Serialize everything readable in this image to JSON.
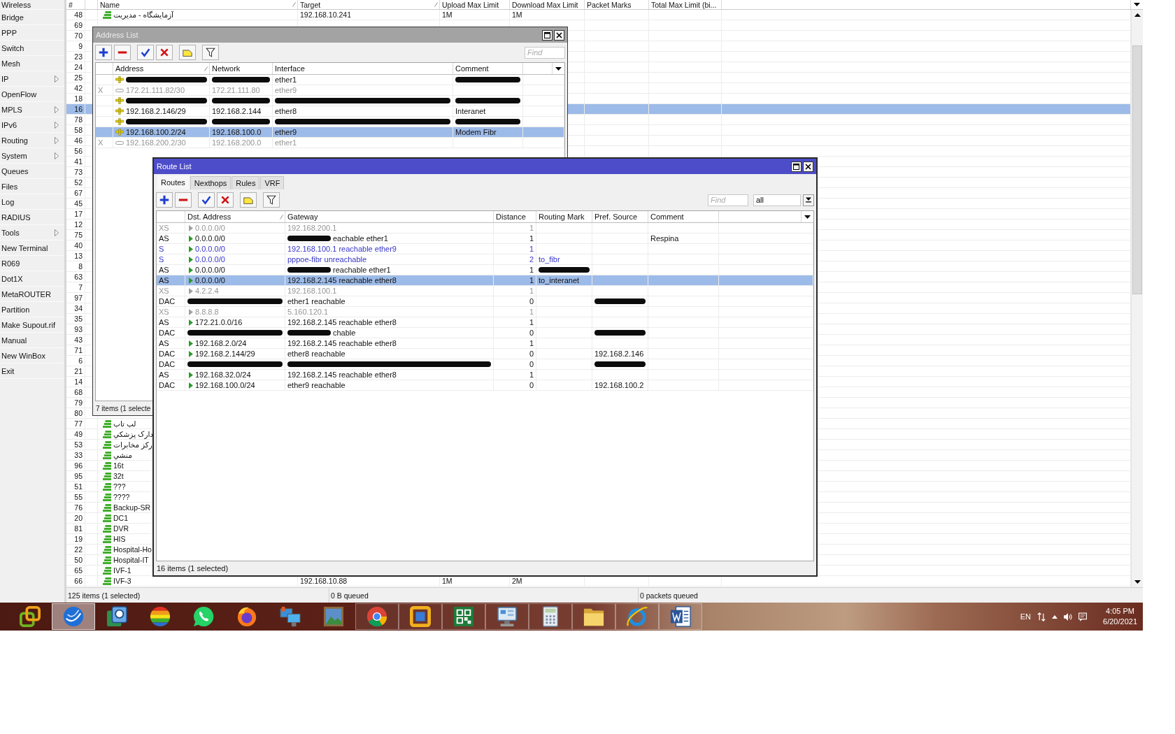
{
  "sidebar": {
    "items": [
      {
        "label": "Wireless",
        "submenu": false
      },
      {
        "label": "Bridge",
        "submenu": false
      },
      {
        "label": "PPP",
        "submenu": false
      },
      {
        "label": "Switch",
        "submenu": false
      },
      {
        "label": "Mesh",
        "submenu": false
      },
      {
        "label": "IP",
        "submenu": true
      },
      {
        "label": "OpenFlow",
        "submenu": false
      },
      {
        "label": "MPLS",
        "submenu": true
      },
      {
        "label": "IPv6",
        "submenu": true
      },
      {
        "label": "Routing",
        "submenu": true
      },
      {
        "label": "System",
        "submenu": true
      },
      {
        "label": "Queues",
        "submenu": false
      },
      {
        "label": "Files",
        "submenu": false
      },
      {
        "label": "Log",
        "submenu": false
      },
      {
        "label": "RADIUS",
        "submenu": false
      },
      {
        "label": "Tools",
        "submenu": true
      },
      {
        "label": "New Terminal",
        "submenu": false
      },
      {
        "label": "R069",
        "submenu": false
      },
      {
        "label": "Dot1X",
        "submenu": false
      },
      {
        "label": "MetaROUTER",
        "submenu": false
      },
      {
        "label": "Partition",
        "submenu": false
      },
      {
        "label": "Make Supout.rif",
        "submenu": false
      },
      {
        "label": "Manual",
        "submenu": false
      },
      {
        "label": "New WinBox",
        "submenu": false
      },
      {
        "label": "Exit",
        "submenu": false
      }
    ]
  },
  "queue_list": {
    "columns": [
      {
        "label": "#",
        "sorted": false
      },
      {
        "label": "Name",
        "sorted": true
      },
      {
        "label": "Target",
        "sorted": true
      },
      {
        "label": "Upload Max Limit",
        "sorted": false
      },
      {
        "label": "Download Max Limit",
        "sorted": false
      },
      {
        "label": "Packet Marks",
        "sorted": false
      },
      {
        "label": "Total Max Limit (bi...",
        "sorted": false
      }
    ],
    "rows": [
      {
        "number": "48",
        "name": "آزمایشگاه - مدیریت",
        "target": "192.168.10.241",
        "upload": "1M",
        "download": "1M",
        "selected": false
      },
      {
        "number": "69",
        "selected": false
      },
      {
        "number": "70",
        "selected": false
      },
      {
        "number": "9",
        "selected": false
      },
      {
        "number": "23",
        "selected": false
      },
      {
        "number": "24",
        "selected": false
      },
      {
        "number": "25",
        "selected": false
      },
      {
        "number": "42",
        "selected": false
      },
      {
        "number": "18",
        "selected": false
      },
      {
        "number": "16",
        "selected": true
      },
      {
        "number": "78",
        "selected": false
      },
      {
        "number": "58",
        "selected": false
      },
      {
        "number": "46",
        "selected": false
      },
      {
        "number": "56",
        "selected": false
      },
      {
        "number": "41",
        "selected": false
      },
      {
        "number": "73",
        "selected": false
      },
      {
        "number": "52",
        "selected": false
      },
      {
        "number": "67",
        "selected": false
      },
      {
        "number": "45",
        "selected": false
      },
      {
        "number": "17",
        "selected": false
      },
      {
        "number": "12",
        "selected": false
      },
      {
        "number": "75",
        "selected": false
      },
      {
        "number": "40",
        "selected": false
      },
      {
        "number": "13",
        "selected": false
      },
      {
        "number": "8",
        "selected": false
      },
      {
        "number": "63",
        "selected": false
      },
      {
        "number": "7",
        "selected": false
      },
      {
        "number": "97",
        "selected": false
      },
      {
        "number": "34",
        "selected": false
      },
      {
        "number": "35",
        "selected": false
      },
      {
        "number": "93",
        "selected": false
      },
      {
        "number": "43",
        "selected": false
      },
      {
        "number": "71",
        "selected": false
      },
      {
        "number": "6",
        "selected": false
      },
      {
        "number": "21",
        "selected": false
      },
      {
        "number": "14",
        "selected": false
      },
      {
        "number": "68",
        "selected": false
      },
      {
        "number": "79",
        "selected": false
      },
      {
        "number": "80",
        "selected": false
      },
      {
        "number": "77",
        "name": "لب تاب",
        "selected": false
      },
      {
        "number": "49",
        "name": "دارک پزشکي",
        "selected": false
      },
      {
        "number": "53",
        "name": "رکز مخابرات",
        "selected": false
      },
      {
        "number": "33",
        "name": "منشي",
        "selected": false
      },
      {
        "number": "96",
        "name": "16t",
        "selected": false
      },
      {
        "number": "95",
        "name": "32t",
        "selected": false
      },
      {
        "number": "51",
        "name": "???",
        "selected": false
      },
      {
        "number": "55",
        "name": "????",
        "selected": false
      },
      {
        "number": "76",
        "name": "Backup-SR",
        "selected": false
      },
      {
        "number": "20",
        "name": "DC1",
        "selected": false
      },
      {
        "number": "81",
        "name": "DVR",
        "selected": false
      },
      {
        "number": "19",
        "name": "HIS",
        "selected": false
      },
      {
        "number": "22",
        "name": "Hospital-Ho",
        "selected": false
      },
      {
        "number": "50",
        "name": "Hospital-IT",
        "selected": false
      },
      {
        "number": "65",
        "name": "IVF-1",
        "selected": false
      },
      {
        "number": "66",
        "name": "IVF-3",
        "target": "192.168.10.88",
        "upload": "1M",
        "download": "2M",
        "selected": false
      }
    ],
    "status": [
      "125 items (1 selected)",
      "0 B queued",
      "0 packets queued"
    ]
  },
  "address_list": {
    "title": "Address List",
    "active": false,
    "find_placeholder": "Find",
    "columns": [
      {
        "label": "Address",
        "sorted": true
      },
      {
        "label": "Network",
        "sorted": false
      },
      {
        "label": "Interface",
        "sorted": false
      },
      {
        "label": "Comment",
        "sorted": false
      }
    ],
    "rows": [
      {
        "disabled": false,
        "selected": false,
        "interface": "ether1",
        "scribbled": {
          "address": true,
          "network": true,
          "comment": true
        }
      },
      {
        "flag": "X",
        "disabled": true,
        "selected": false,
        "address": "172.21.111.82/30",
        "network": "172.21.111.80",
        "interface": "ether9"
      },
      {
        "disabled": false,
        "selected": false,
        "scribbled": {
          "address": true,
          "network": true,
          "interface": true,
          "comment": true
        }
      },
      {
        "disabled": false,
        "selected": false,
        "address": "192.168.2.146/29",
        "network": "192.168.2.144",
        "interface": "ether8",
        "comment": "Interanet"
      },
      {
        "disabled": false,
        "selected": false,
        "scribbled": {
          "address": true,
          "network": true,
          "interface": true,
          "comment": true
        }
      },
      {
        "disabled": false,
        "selected": true,
        "address": "192.168.100.2/24",
        "network": "192.168.100.0",
        "interface": "ether9",
        "comment": "Modem Fibr"
      },
      {
        "flag": "X",
        "disabled": true,
        "selected": false,
        "address": "192.168.200.2/30",
        "network": "192.168.200.0",
        "interface": "ether1"
      }
    ],
    "status": "7 items (1 selecte"
  },
  "route_list": {
    "title": "Route List",
    "active": true,
    "tabs": [
      {
        "label": "Routes",
        "selected": true
      },
      {
        "label": "Nexthops",
        "selected": false
      },
      {
        "label": "Rules",
        "selected": false
      },
      {
        "label": "VRF",
        "selected": false
      }
    ],
    "find_placeholder": "Find",
    "filter_value": "all",
    "columns": [
      {
        "label": "Dst. Address",
        "sorted": true
      },
      {
        "label": "Gateway",
        "sorted": false
      },
      {
        "label": "Distance",
        "sorted": false
      },
      {
        "label": "Routing Mark",
        "sorted": false
      },
      {
        "label": "Pref. Source",
        "sorted": false
      },
      {
        "label": "Comment",
        "sorted": false
      }
    ],
    "rows": [
      {
        "flags": "XS",
        "kind": "inactive",
        "selected": false,
        "dst": "0.0.0.0/0",
        "gateway": "192.168.200.1",
        "distance": "1"
      },
      {
        "flags": "AS",
        "kind": "active",
        "selected": false,
        "dst": "0.0.0.0/0",
        "gateway": "eachable ether1",
        "distance": "1",
        "comment": "Respina",
        "scribbled": {
          "gateway": true
        }
      },
      {
        "flags": "S",
        "kind": "static",
        "selected": false,
        "dst": "0.0.0.0/0",
        "gateway": "192.168.100.1 reachable ether9",
        "distance": "1"
      },
      {
        "flags": "S",
        "kind": "static",
        "selected": false,
        "dst": "0.0.0.0/0",
        "gateway": "pppoe-fibr unreachable",
        "distance": "2",
        "routing_mark": "to_fibr"
      },
      {
        "flags": "AS",
        "kind": "active",
        "selected": false,
        "dst": "0.0.0.0/0",
        "gateway": "reachable ether1",
        "distance": "1",
        "scribbled": {
          "gateway": true,
          "routing_mark": true
        }
      },
      {
        "flags": "AS",
        "kind": "active",
        "selected": true,
        "dst": "0.0.0.0/0",
        "gateway": "192.168.2.145 reachable ether8",
        "distance": "1",
        "routing_mark": "to_interanet"
      },
      {
        "flags": "XS",
        "kind": "inactive",
        "selected": false,
        "dst": "4.2.2.4",
        "gateway": "192.168.100.1",
        "distance": "1"
      },
      {
        "flags": "DAC",
        "kind": "active",
        "selected": false,
        "gateway": "ether1 reachable",
        "distance": "0",
        "scribbled": {
          "dst": true,
          "pref_source": true
        }
      },
      {
        "flags": "XS",
        "kind": "inactive",
        "selected": false,
        "dst": "8.8.8.8",
        "gateway": "5.160.120.1",
        "distance": "1"
      },
      {
        "flags": "AS",
        "kind": "active",
        "selected": false,
        "dst": "172.21.0.0/16",
        "gateway": "192.168.2.145 reachable ether8",
        "distance": "1"
      },
      {
        "flags": "DAC",
        "kind": "active",
        "selected": false,
        "gateway": "chable",
        "distance": "0",
        "scribbled": {
          "dst": true,
          "gateway": true,
          "pref_source": true
        }
      },
      {
        "flags": "AS",
        "kind": "active",
        "selected": false,
        "dst": "192.168.2.0/24",
        "gateway": "192.168.2.145 reachable ether8",
        "distance": "1"
      },
      {
        "flags": "DAC",
        "kind": "active",
        "selected": false,
        "dst": "192.168.2.144/29",
        "gateway": "ether8 reachable",
        "distance": "0",
        "pref_source": "192.168.2.146"
      },
      {
        "flags": "DAC",
        "kind": "active",
        "selected": false,
        "distance": "0",
        "scribbled": {
          "dst": true,
          "gateway": true,
          "pref_source": true
        }
      },
      {
        "flags": "AS",
        "kind": "active",
        "selected": false,
        "dst": "192.168.32.0/24",
        "gateway": "192.168.2.145 reachable ether8",
        "distance": "1"
      },
      {
        "flags": "DAC",
        "kind": "active",
        "selected": false,
        "dst": "192.168.100.0/24",
        "gateway": "ether9 reachable",
        "distance": "0",
        "pref_source": "192.168.100.2"
      }
    ],
    "status": "16 items (1 selected)"
  },
  "taskbar": {
    "apps": [
      {
        "selected": false,
        "running": false
      },
      {
        "selected": true,
        "running": true
      },
      {
        "selected": false,
        "running": false
      },
      {
        "selected": false,
        "running": false
      },
      {
        "selected": false,
        "running": false
      },
      {
        "selected": false,
        "running": false
      },
      {
        "selected": false,
        "running": false
      },
      {
        "selected": false,
        "running": false
      },
      {
        "selected": false,
        "running": true
      },
      {
        "selected": false,
        "running": true
      },
      {
        "selected": false,
        "running": true
      },
      {
        "selected": false,
        "running": true
      },
      {
        "selected": false,
        "running": true
      },
      {
        "selected": false,
        "running": true
      },
      {
        "selected": false,
        "running": true
      },
      {
        "selected": false,
        "running": true
      }
    ],
    "language": "EN",
    "time": "4:05 PM",
    "date": "6/20/2021"
  }
}
